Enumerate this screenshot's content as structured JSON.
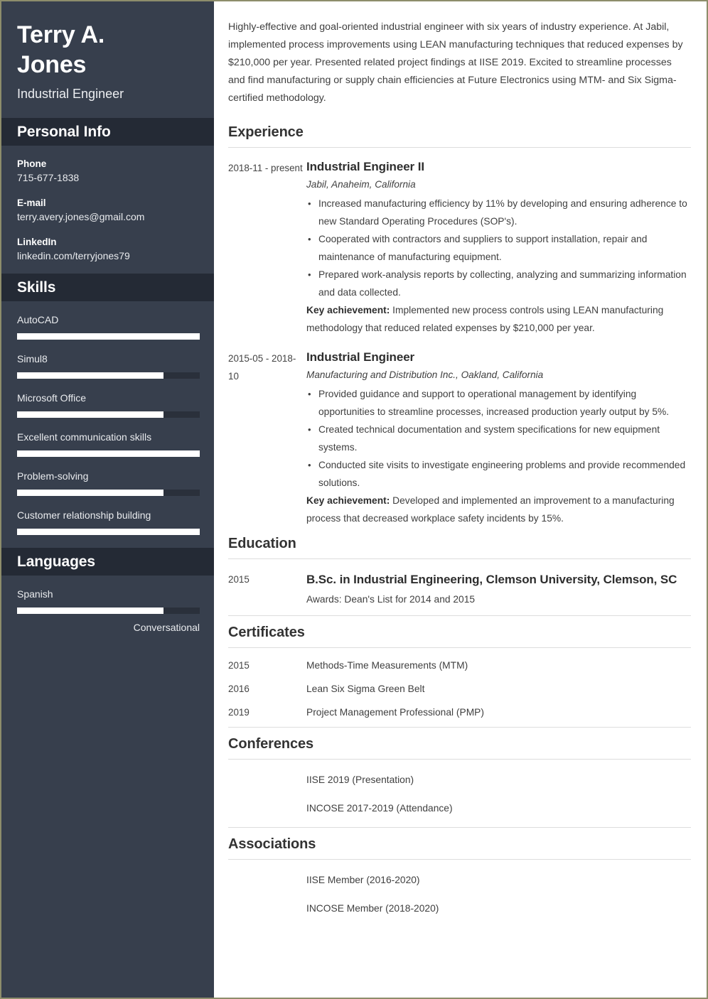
{
  "theme": {
    "sidebar_bg": "#373f4d",
    "sidebar_header_bg": "#242a35",
    "bar_fill": "#ffffff",
    "bar_track": "#2a303b",
    "page_border": "#8d8d6b",
    "text_dark": "#3f3f3f"
  },
  "sidebar": {
    "full_name": "Terry A. Jones",
    "job_title": "Industrial Engineer",
    "personal_info": {
      "heading": "Personal Info",
      "items": [
        {
          "label": "Phone",
          "value": "715-677-1838"
        },
        {
          "label": "E-mail",
          "value": "terry.avery.jones@gmail.com"
        },
        {
          "label": "LinkedIn",
          "value": "linkedin.com/terryjones79"
        }
      ]
    },
    "skills": {
      "heading": "Skills",
      "items": [
        {
          "name": "AutoCAD",
          "level": 100
        },
        {
          "name": "Simul8",
          "level": 80
        },
        {
          "name": "Microsoft Office",
          "level": 80
        },
        {
          "name": "Excellent communication skills",
          "level": 100
        },
        {
          "name": "Problem-solving",
          "level": 80
        },
        {
          "name": "Customer relationship building",
          "level": 100
        }
      ]
    },
    "languages": {
      "heading": "Languages",
      "items": [
        {
          "name": "Spanish",
          "level": 80,
          "proficiency": "Conversational"
        }
      ]
    }
  },
  "main": {
    "summary": "Highly-effective and goal-oriented industrial engineer with six years of industry experience. At Jabil, implemented process improvements using LEAN manufacturing techniques that reduced expenses by $210,000 per year. Presented related project findings at IISE 2019. Excited to streamline processes and find manufacturing or supply chain efficiencies at Future Electronics using MTM- and Six Sigma-certified methodology.",
    "experience": {
      "heading": "Experience",
      "entries": [
        {
          "date": "2018-11 - present",
          "role": "Industrial Engineer II",
          "org": "Jabil, Anaheim, California",
          "bullets": [
            "Increased manufacturing efficiency by 11% by developing and ensuring adherence to new Standard Operating Procedures (SOP's).",
            "Cooperated with contractors and suppliers to support installation, repair and maintenance of manufacturing equipment.",
            "Prepared work-analysis reports by collecting, analyzing and summarizing information and data collected."
          ],
          "key_achievement_label": "Key achievement:",
          "key_achievement": "Implemented new process controls using LEAN manufacturing methodology that reduced related expenses by $210,000 per year."
        },
        {
          "date": "2015-05 - 2018-10",
          "role": "Industrial Engineer",
          "org": "Manufacturing and Distribution Inc., Oakland, California",
          "bullets": [
            "Provided guidance and support to operational management by identifying opportunities to streamline processes, increased production yearly output by 5%.",
            "Created technical documentation and system specifications for new equipment systems.",
            "Conducted site visits to investigate engineering problems and provide recommended solutions."
          ],
          "key_achievement_label": "Key achievement:",
          "key_achievement": "Developed and implemented an improvement to a manufacturing process that decreased workplace safety incidents by 15%."
        }
      ]
    },
    "education": {
      "heading": "Education",
      "entries": [
        {
          "date": "2015",
          "degree": "B.Sc. in Industrial Engineering, Clemson University, Clemson, SC",
          "note": "Awards: Dean's List for 2014 and 2015"
        }
      ]
    },
    "certificates": {
      "heading": "Certificates",
      "entries": [
        {
          "date": "2015",
          "text": "Methods-Time Measurements (MTM)"
        },
        {
          "date": "2016",
          "text": "Lean Six Sigma Green Belt"
        },
        {
          "date": "2019",
          "text": "Project Management Professional (PMP)"
        }
      ]
    },
    "conferences": {
      "heading": "Conferences",
      "entries": [
        {
          "date": "",
          "text": "IISE 2019 (Presentation)"
        },
        {
          "date": "",
          "text": "INCOSE 2017-2019 (Attendance)"
        }
      ]
    },
    "associations": {
      "heading": "Associations",
      "entries": [
        {
          "date": "",
          "text": "IISE Member (2016-2020)"
        },
        {
          "date": "",
          "text": "INCOSE Member (2018-2020)"
        }
      ]
    }
  }
}
